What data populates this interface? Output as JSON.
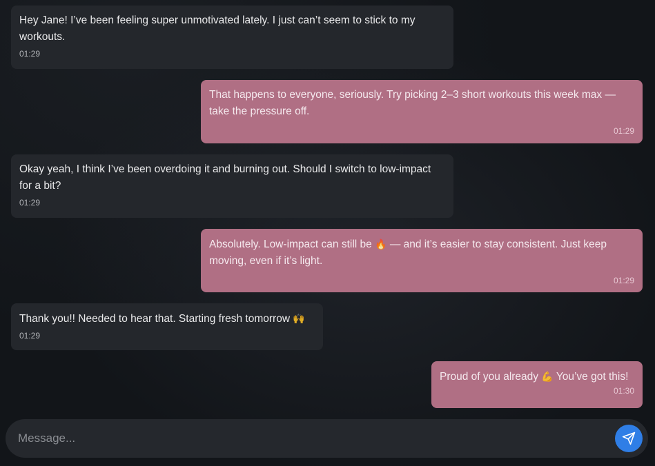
{
  "messages": [
    {
      "dir": "in",
      "text": "Hey Jane! I’ve been feeling super unmotivated lately. I just can’t seem to stick to my workouts.",
      "time": "01:29"
    },
    {
      "dir": "out",
      "text": "That happens to everyone, seriously. Try picking 2–3 short workouts this week max — take the pressure off.",
      "time": "01:29"
    },
    {
      "dir": "in",
      "text": "Okay yeah, I think I’ve been overdoing it and burning out. Should I switch to low-impact for a bit?",
      "time": "01:29"
    },
    {
      "dir": "out",
      "text_before": "Absolutely. Low-impact can still be",
      "emoji": "🔥",
      "text_after": "— and it’s easier to stay consistent. Just keep moving, even if it’s light.",
      "time": "01:29"
    },
    {
      "dir": "in",
      "text_before": "Thank you!! Needed to hear that. Starting fresh tomorrow",
      "emoji": "🙌",
      "text_after": "",
      "time": "01:29"
    },
    {
      "dir": "out",
      "text_before": "Proud of you already",
      "emoji": "💪",
      "text_after": "You’ve got this!",
      "time": "01:30"
    }
  ],
  "composer": {
    "placeholder": "Message...",
    "send_icon": "send-icon"
  },
  "colors": {
    "background": "#121519",
    "incoming_bubble": "#24272c",
    "outgoing_bubble": "#b06f84",
    "send_button": "#2f7ee6"
  }
}
